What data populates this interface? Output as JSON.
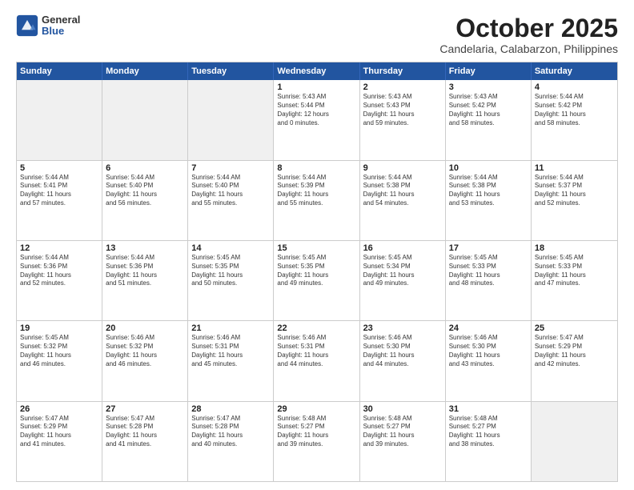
{
  "logo": {
    "general": "General",
    "blue": "Blue"
  },
  "title": "October 2025",
  "subtitle": "Candelaria, Calabarzon, Philippines",
  "weekdays": [
    "Sunday",
    "Monday",
    "Tuesday",
    "Wednesday",
    "Thursday",
    "Friday",
    "Saturday"
  ],
  "rows": [
    [
      {
        "day": "",
        "info": "",
        "shaded": true
      },
      {
        "day": "",
        "info": "",
        "shaded": true
      },
      {
        "day": "",
        "info": "",
        "shaded": true
      },
      {
        "day": "1",
        "info": "Sunrise: 5:43 AM\nSunset: 5:44 PM\nDaylight: 12 hours\nand 0 minutes."
      },
      {
        "day": "2",
        "info": "Sunrise: 5:43 AM\nSunset: 5:43 PM\nDaylight: 11 hours\nand 59 minutes."
      },
      {
        "day": "3",
        "info": "Sunrise: 5:43 AM\nSunset: 5:42 PM\nDaylight: 11 hours\nand 58 minutes."
      },
      {
        "day": "4",
        "info": "Sunrise: 5:44 AM\nSunset: 5:42 PM\nDaylight: 11 hours\nand 58 minutes."
      }
    ],
    [
      {
        "day": "5",
        "info": "Sunrise: 5:44 AM\nSunset: 5:41 PM\nDaylight: 11 hours\nand 57 minutes."
      },
      {
        "day": "6",
        "info": "Sunrise: 5:44 AM\nSunset: 5:40 PM\nDaylight: 11 hours\nand 56 minutes."
      },
      {
        "day": "7",
        "info": "Sunrise: 5:44 AM\nSunset: 5:40 PM\nDaylight: 11 hours\nand 55 minutes."
      },
      {
        "day": "8",
        "info": "Sunrise: 5:44 AM\nSunset: 5:39 PM\nDaylight: 11 hours\nand 55 minutes."
      },
      {
        "day": "9",
        "info": "Sunrise: 5:44 AM\nSunset: 5:38 PM\nDaylight: 11 hours\nand 54 minutes."
      },
      {
        "day": "10",
        "info": "Sunrise: 5:44 AM\nSunset: 5:38 PM\nDaylight: 11 hours\nand 53 minutes."
      },
      {
        "day": "11",
        "info": "Sunrise: 5:44 AM\nSunset: 5:37 PM\nDaylight: 11 hours\nand 52 minutes."
      }
    ],
    [
      {
        "day": "12",
        "info": "Sunrise: 5:44 AM\nSunset: 5:36 PM\nDaylight: 11 hours\nand 52 minutes."
      },
      {
        "day": "13",
        "info": "Sunrise: 5:44 AM\nSunset: 5:36 PM\nDaylight: 11 hours\nand 51 minutes."
      },
      {
        "day": "14",
        "info": "Sunrise: 5:45 AM\nSunset: 5:35 PM\nDaylight: 11 hours\nand 50 minutes."
      },
      {
        "day": "15",
        "info": "Sunrise: 5:45 AM\nSunset: 5:35 PM\nDaylight: 11 hours\nand 49 minutes."
      },
      {
        "day": "16",
        "info": "Sunrise: 5:45 AM\nSunset: 5:34 PM\nDaylight: 11 hours\nand 49 minutes."
      },
      {
        "day": "17",
        "info": "Sunrise: 5:45 AM\nSunset: 5:33 PM\nDaylight: 11 hours\nand 48 minutes."
      },
      {
        "day": "18",
        "info": "Sunrise: 5:45 AM\nSunset: 5:33 PM\nDaylight: 11 hours\nand 47 minutes."
      }
    ],
    [
      {
        "day": "19",
        "info": "Sunrise: 5:45 AM\nSunset: 5:32 PM\nDaylight: 11 hours\nand 46 minutes."
      },
      {
        "day": "20",
        "info": "Sunrise: 5:46 AM\nSunset: 5:32 PM\nDaylight: 11 hours\nand 46 minutes."
      },
      {
        "day": "21",
        "info": "Sunrise: 5:46 AM\nSunset: 5:31 PM\nDaylight: 11 hours\nand 45 minutes."
      },
      {
        "day": "22",
        "info": "Sunrise: 5:46 AM\nSunset: 5:31 PM\nDaylight: 11 hours\nand 44 minutes."
      },
      {
        "day": "23",
        "info": "Sunrise: 5:46 AM\nSunset: 5:30 PM\nDaylight: 11 hours\nand 44 minutes."
      },
      {
        "day": "24",
        "info": "Sunrise: 5:46 AM\nSunset: 5:30 PM\nDaylight: 11 hours\nand 43 minutes."
      },
      {
        "day": "25",
        "info": "Sunrise: 5:47 AM\nSunset: 5:29 PM\nDaylight: 11 hours\nand 42 minutes."
      }
    ],
    [
      {
        "day": "26",
        "info": "Sunrise: 5:47 AM\nSunset: 5:29 PM\nDaylight: 11 hours\nand 41 minutes."
      },
      {
        "day": "27",
        "info": "Sunrise: 5:47 AM\nSunset: 5:28 PM\nDaylight: 11 hours\nand 41 minutes."
      },
      {
        "day": "28",
        "info": "Sunrise: 5:47 AM\nSunset: 5:28 PM\nDaylight: 11 hours\nand 40 minutes."
      },
      {
        "day": "29",
        "info": "Sunrise: 5:48 AM\nSunset: 5:27 PM\nDaylight: 11 hours\nand 39 minutes."
      },
      {
        "day": "30",
        "info": "Sunrise: 5:48 AM\nSunset: 5:27 PM\nDaylight: 11 hours\nand 39 minutes."
      },
      {
        "day": "31",
        "info": "Sunrise: 5:48 AM\nSunset: 5:27 PM\nDaylight: 11 hours\nand 38 minutes."
      },
      {
        "day": "",
        "info": "",
        "shaded": true
      }
    ]
  ]
}
